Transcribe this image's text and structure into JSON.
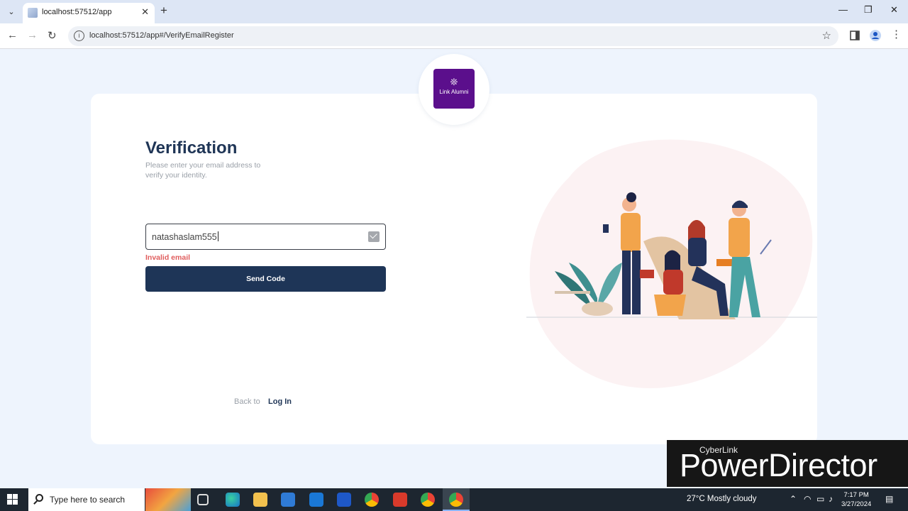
{
  "browser": {
    "tab_title": "localhost:57512/app",
    "url": "localhost:57512/app#/VerifyEmailRegister",
    "new_tab_symbol": "+",
    "close_tab_symbol": "✕"
  },
  "logo": {
    "text": "Link Alumni",
    "brand_color": "#5b0f8c"
  },
  "form": {
    "heading": "Verification",
    "subtitle": "Please enter your email address to verify your identity.",
    "email_value": "natashaslam555",
    "error": "Invalid email",
    "send_button": "Send Code",
    "back_text": "Back to",
    "login_link": "Log In"
  },
  "colors": {
    "primary": "#1e3557",
    "error": "#e05d5d",
    "page_bg": "#eef4fd"
  },
  "watermark": {
    "small": "CyberLink",
    "big": "PowerDirector"
  },
  "taskbar": {
    "search_placeholder": "Type here to search",
    "weather": "27°C  Mostly cloudy",
    "time": "7:17 PM",
    "date": "3/27/2024"
  }
}
